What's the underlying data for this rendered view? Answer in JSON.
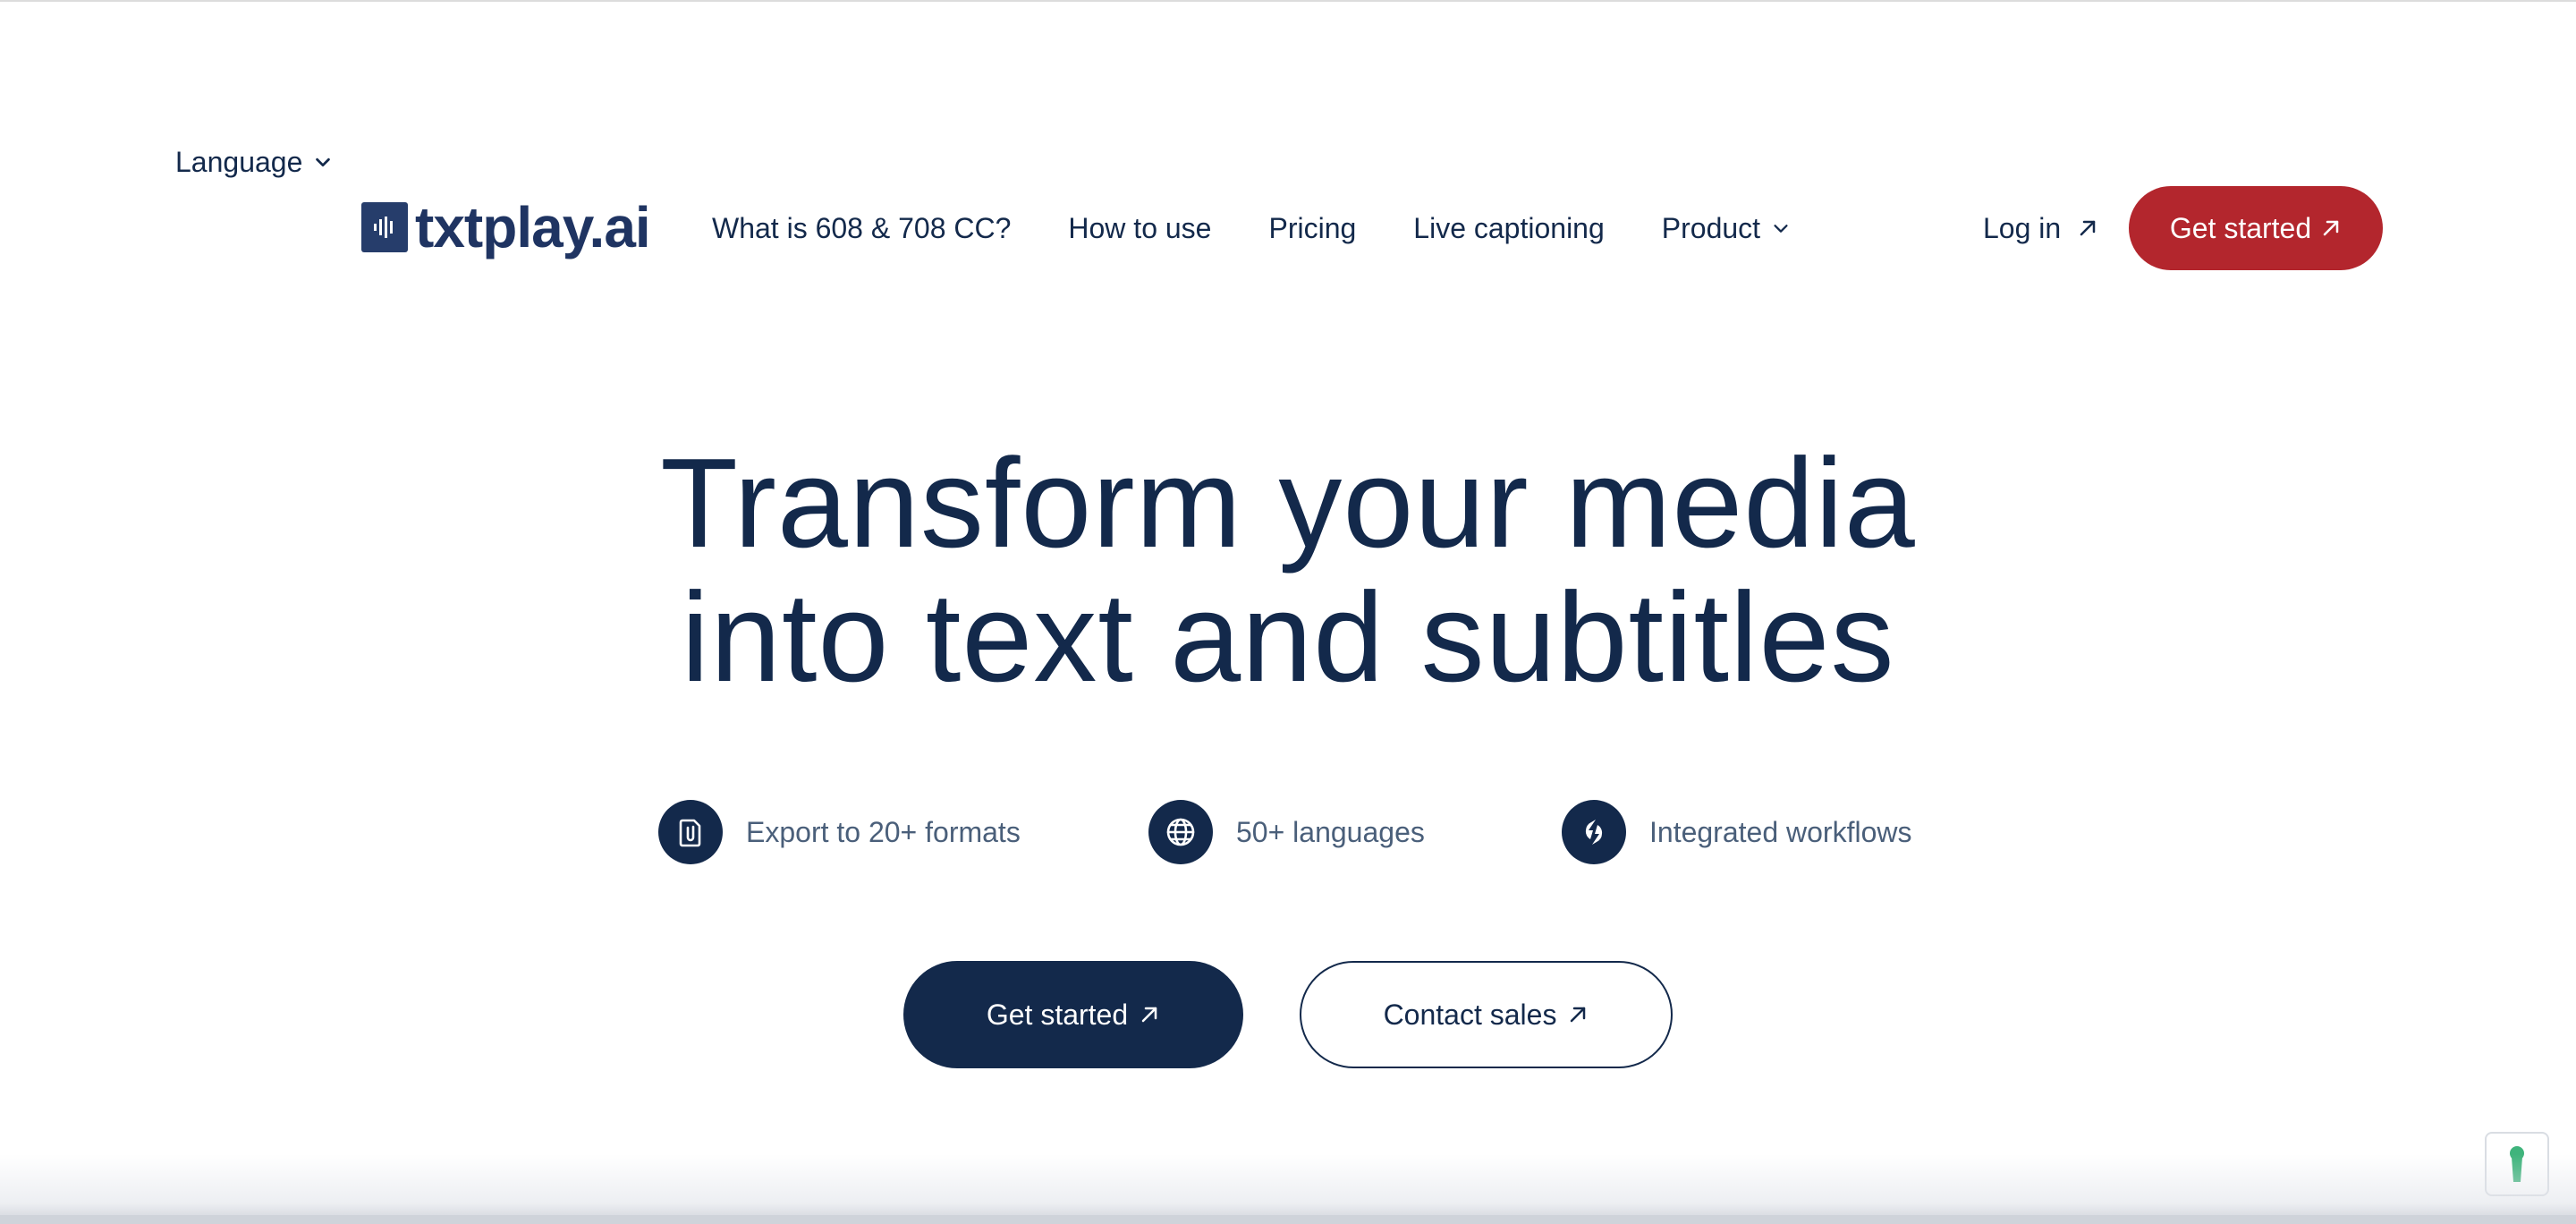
{
  "language": {
    "label": "Language"
  },
  "header": {
    "logo_text": "txtplay.ai",
    "nav": [
      {
        "label": "What is 608 & 708 CC?"
      },
      {
        "label": "How to use"
      },
      {
        "label": "Pricing"
      },
      {
        "label": "Live captioning"
      },
      {
        "label": "Product"
      }
    ],
    "login_label": "Log in",
    "cta_label": "Get started"
  },
  "hero": {
    "title_line1": "Transform your media",
    "title_line2": "into text and subtitles",
    "features": [
      {
        "label": "Export to 20+ formats",
        "icon": "file-clip-icon"
      },
      {
        "label": "50+ languages",
        "icon": "globe-icon"
      },
      {
        "label": "Integrated workflows",
        "icon": "sync-icon"
      }
    ],
    "primary_cta": "Get started",
    "secondary_cta": "Contact sales"
  },
  "colors": {
    "brand_navy": "#13294b",
    "accent_red": "#b3262d",
    "privacy_green": "#3fb47c"
  }
}
